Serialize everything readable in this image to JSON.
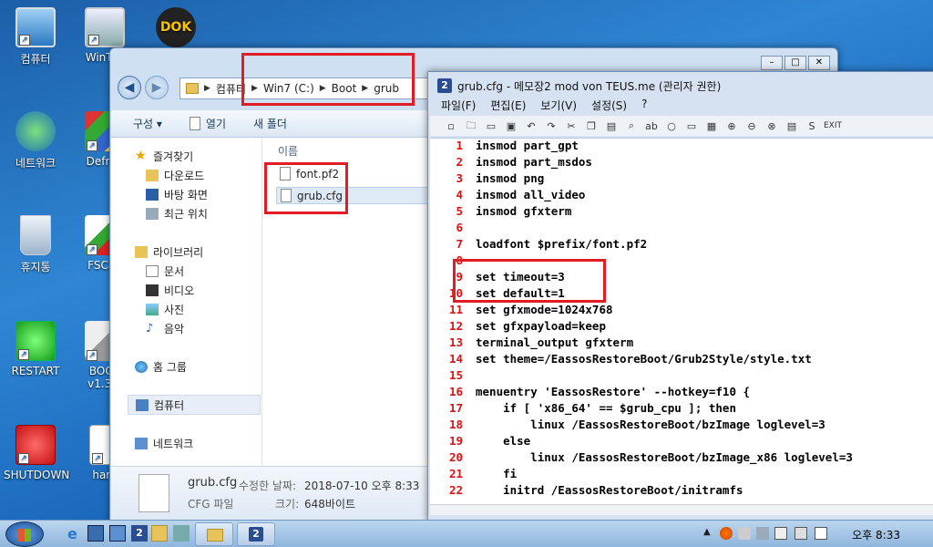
{
  "desktop": {
    "icons": [
      {
        "label": "컴퓨터"
      },
      {
        "label": "WinToo"
      },
      {
        "label": "네트워크"
      },
      {
        "label": "Defrag"
      },
      {
        "label": "휴지통"
      },
      {
        "label": "FSCap"
      },
      {
        "label": "RESTART"
      },
      {
        "label": "BOOT v1.3.2"
      },
      {
        "label": "SHUTDOWN"
      },
      {
        "label": "hard"
      },
      {
        "label": "DOK"
      }
    ]
  },
  "explorer": {
    "address": [
      "컴퓨터",
      "Win7 (C:)",
      "Boot",
      "grub"
    ],
    "toolbar": {
      "organize": "구성 ▾",
      "open": "열기",
      "new_folder": "새 폴더"
    },
    "nav": {
      "favorites": "즐겨찾기",
      "downloads": "다운로드",
      "desktop": "바탕 화면",
      "recent": "최근 위치",
      "libraries": "라이브러리",
      "documents": "문서",
      "videos": "비디오",
      "pictures": "사진",
      "music": "음악",
      "homegroup": "홈 그룹",
      "computer": "컴퓨터",
      "network": "네트워크"
    },
    "column_name": "이름",
    "files": [
      "font.pf2",
      "grub.cfg"
    ],
    "details": {
      "filename": "grub.cfg",
      "modified_label": "수정한 날짜:",
      "modified_value": "2018-07-10 오후 8:33",
      "type": "CFG 파일",
      "size_label": "크기:",
      "size_value": "648바이트"
    }
  },
  "notepad": {
    "title": "grub.cfg - 메모장2 mod von TEUS.me (관리자 권한)",
    "app_icon": "2",
    "menu": [
      "파일(F)",
      "편집(E)",
      "보기(V)",
      "설정(S)",
      "?"
    ],
    "toolbar_exit": "EXIT",
    "toolbar_s": "S",
    "lines": [
      {
        "n": "1",
        "t": "insmod part_gpt"
      },
      {
        "n": "2",
        "t": "insmod part_msdos"
      },
      {
        "n": "3",
        "t": "insmod png"
      },
      {
        "n": "4",
        "t": "insmod all_video"
      },
      {
        "n": "5",
        "t": "insmod gfxterm"
      },
      {
        "n": "6",
        "t": ""
      },
      {
        "n": "7",
        "t": "loadfont $prefix/font.pf2"
      },
      {
        "n": "8",
        "t": ""
      },
      {
        "n": "9",
        "t": "set timeout=3"
      },
      {
        "n": "10",
        "t": "set default=1"
      },
      {
        "n": "11",
        "t": "set gfxmode=1024x768"
      },
      {
        "n": "12",
        "t": "set gfxpayload=keep"
      },
      {
        "n": "13",
        "t": "terminal_output gfxterm"
      },
      {
        "n": "14",
        "t": "set theme=/EassosRestoreBoot/Grub2Style/style.txt"
      },
      {
        "n": "15",
        "t": ""
      },
      {
        "n": "16",
        "t": "menuentry 'EassosRestore' --hotkey=f10 {"
      },
      {
        "n": "17",
        "t": "    if [ 'x86_64' == $grub_cpu ]; then"
      },
      {
        "n": "18",
        "t": "        linux /EassosRestoreBoot/bzImage loglevel=3"
      },
      {
        "n": "19",
        "t": "    else"
      },
      {
        "n": "20",
        "t": "        linux /EassosRestoreBoot/bzImage_x86 loglevel=3"
      },
      {
        "n": "21",
        "t": "    fi"
      },
      {
        "n": "22",
        "t": "    initrd /EassosRestoreBoot/initramfs"
      }
    ]
  },
  "taskbar": {
    "clock": "오후 8:33",
    "notepad_task_label": "2"
  },
  "colors": {
    "highlight_box": "#e11c24",
    "line_numbers": "#dd1111"
  }
}
